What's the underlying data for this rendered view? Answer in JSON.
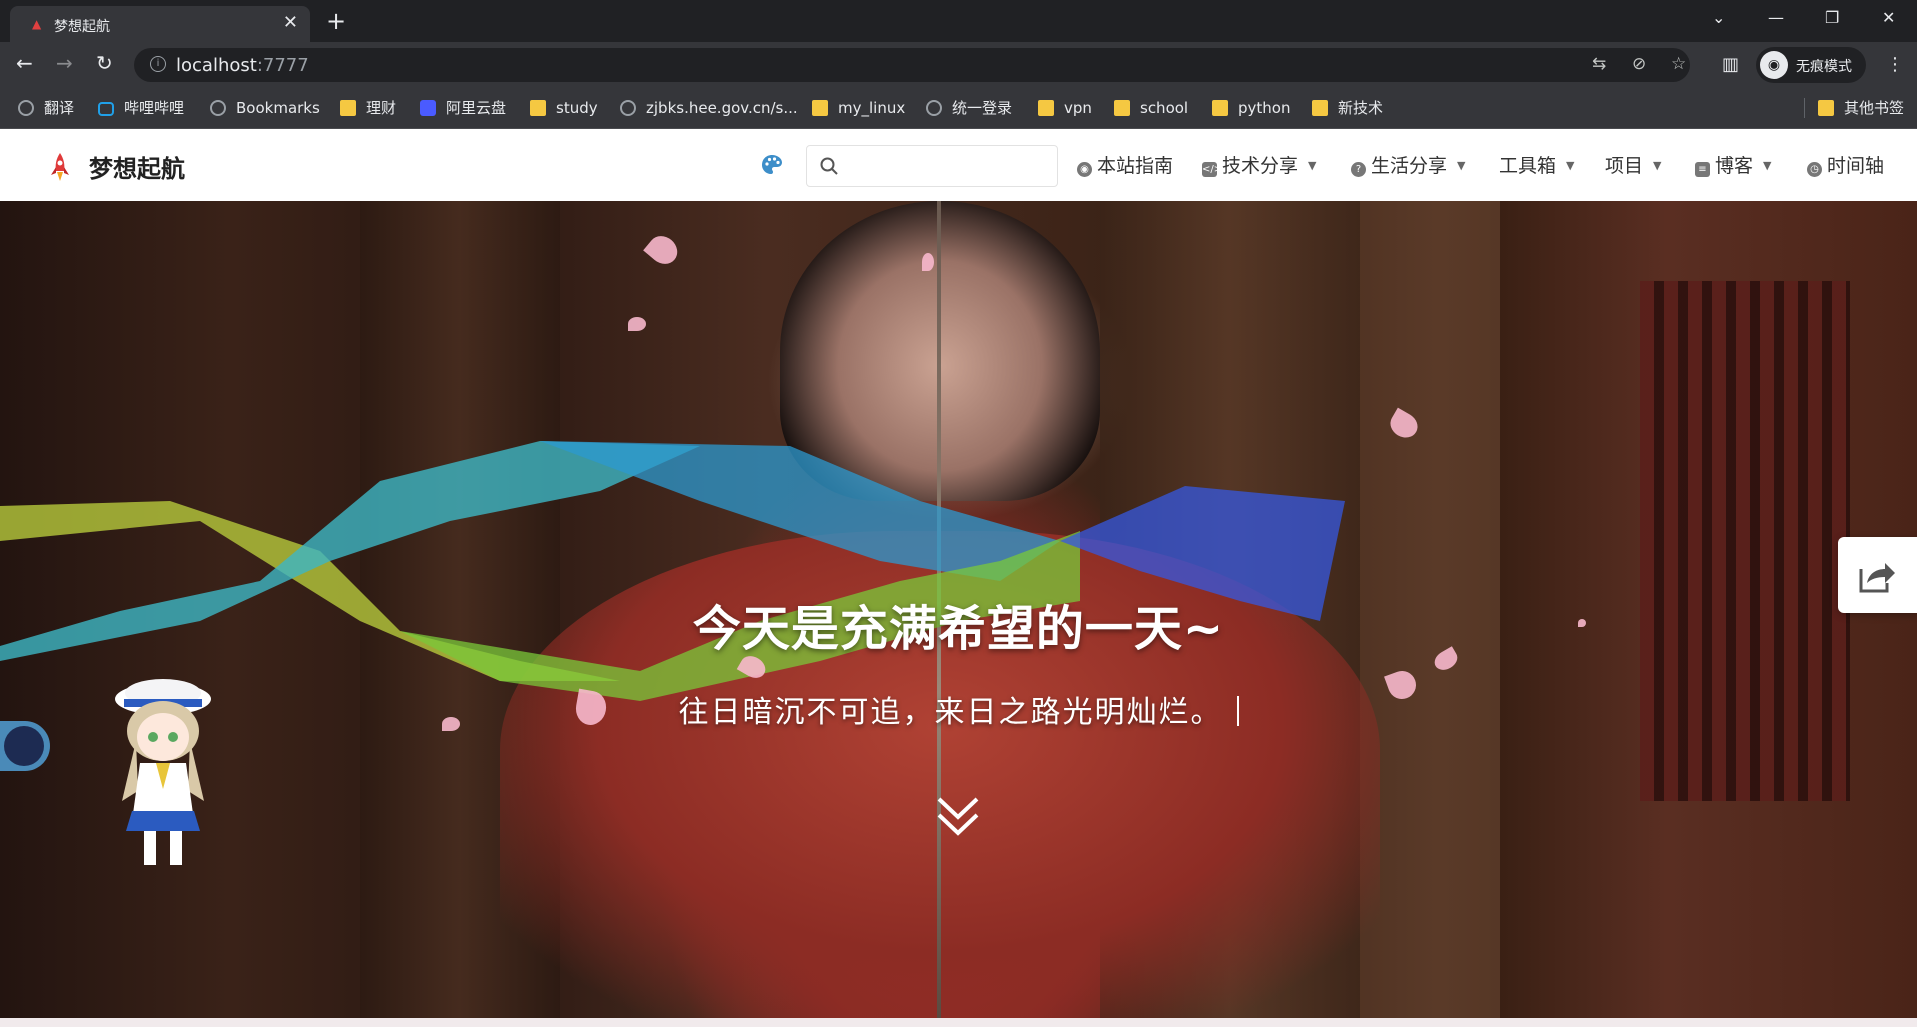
{
  "browser": {
    "tab_title": "梦想起航",
    "url_host": "localhost",
    "url_port": ":7777",
    "profile_label": "无痕模式",
    "bookmarks": [
      {
        "label": "翻译",
        "icon": "translate-icon"
      },
      {
        "label": "哔哩哔哩",
        "icon": "bilibili-icon"
      },
      {
        "label": "Bookmarks",
        "icon": "globe-icon"
      },
      {
        "label": "理财",
        "icon": "folder-icon"
      },
      {
        "label": "阿里云盘",
        "icon": "aliyun-icon"
      },
      {
        "label": "study",
        "icon": "folder-icon"
      },
      {
        "label": "zjbks.hee.gov.cn/s...",
        "icon": "globe-icon"
      },
      {
        "label": "my_linux",
        "icon": "folder-icon"
      },
      {
        "label": "统一登录",
        "icon": "globe-icon"
      },
      {
        "label": "vpn",
        "icon": "folder-icon"
      },
      {
        "label": "school",
        "icon": "folder-icon"
      },
      {
        "label": "python",
        "icon": "folder-icon"
      },
      {
        "label": "新技术",
        "icon": "folder-icon"
      }
    ],
    "other_bookmarks": "其他书签"
  },
  "site": {
    "logo_text": "梦想起航",
    "search_placeholder": "",
    "menu": [
      {
        "label": "本站指南",
        "icon": "eye-icon",
        "dropdown": false
      },
      {
        "label": "技术分享",
        "icon": "code-icon",
        "dropdown": true
      },
      {
        "label": "生活分享",
        "icon": "question-icon",
        "dropdown": true
      },
      {
        "label": "工具箱",
        "icon": "",
        "dropdown": true
      },
      {
        "label": "项目",
        "icon": "",
        "dropdown": true
      },
      {
        "label": "博客",
        "icon": "document-icon",
        "dropdown": true
      },
      {
        "label": "时间轴",
        "icon": "clock-icon",
        "dropdown": false
      }
    ]
  },
  "hero": {
    "title": "今天是充满希望的一天~",
    "subtitle": "往日暗沉不可追，来日之路光明灿烂。"
  },
  "colors": {
    "chrome_dark": "#202124",
    "chrome_mid": "#35363a",
    "folder": "#f5c842",
    "accent_red": "#a8372e"
  }
}
